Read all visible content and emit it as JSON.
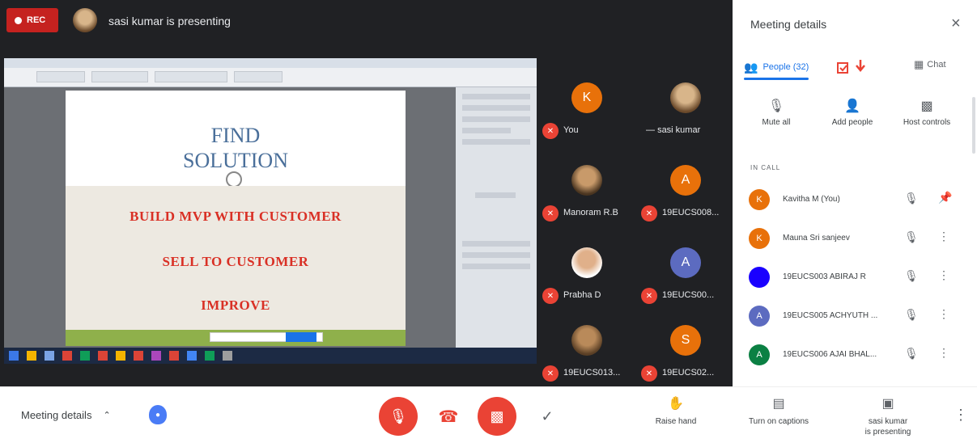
{
  "topbar": {
    "rec_label": "REC",
    "presenting_text": "sasi kumar is presenting"
  },
  "slide": {
    "title_line1": "FIND",
    "title_line2": "SOLUTION",
    "lines": [
      "BUILD MVP WITH CUSTOMER",
      "SELL TO CUSTOMER",
      "IMPROVE"
    ]
  },
  "tiles": [
    {
      "initial": "K",
      "name": "You",
      "color": "#e8710a"
    },
    {
      "initial": "",
      "name": "sasi kumar",
      "color": "#8a6a45"
    },
    {
      "initial": "",
      "name": "Manoram R.B",
      "color": "#6b4a2b"
    },
    {
      "initial": "A",
      "name": "19EUCS008...",
      "color": "#e8710a"
    },
    {
      "initial": "",
      "name": "Prabha D",
      "color": "#b06b4a"
    },
    {
      "initial": "A",
      "name": "19EUCS00...",
      "color": "#5c6bc0"
    },
    {
      "initial": "",
      "name": "19EUCS013...",
      "color": "#7a5a3a"
    },
    {
      "initial": "S",
      "name": "19EUCS02...",
      "color": "#e8710a"
    }
  ],
  "panel": {
    "title": "Meeting details",
    "close_icon": "×",
    "tab_people": "People (32)",
    "tab_chat": "Chat",
    "actions": [
      "Mute all",
      "Add people",
      "Host controls"
    ],
    "section_label": "IN CALL",
    "people": [
      {
        "initial": "K",
        "name": "Kavitha M (You)",
        "color": "#e8710a"
      },
      {
        "initial": "K",
        "name": "Mauna Sri sanjeev",
        "color": "#e8710a"
      },
      {
        "initial": "",
        "name": "19EUCS003 ABIRAJ R",
        "color": "#1a00ff"
      },
      {
        "initial": "A",
        "name": "19EUCS005 ACHYUTH ...",
        "color": "#5c6bc0"
      },
      {
        "initial": "A",
        "name": "19EUCS006 AJAI BHAL...",
        "color": "#0b8043"
      }
    ]
  },
  "bottom": {
    "meeting_details": "Meeting details",
    "raise_hand": "Raise hand",
    "captions": "Turn on captions",
    "presenting_line1": "sasi kumar",
    "presenting_line2": "is presenting"
  },
  "colors": {
    "red": "#ea4335",
    "accent": "#1a73e8",
    "dark": "#202124"
  }
}
